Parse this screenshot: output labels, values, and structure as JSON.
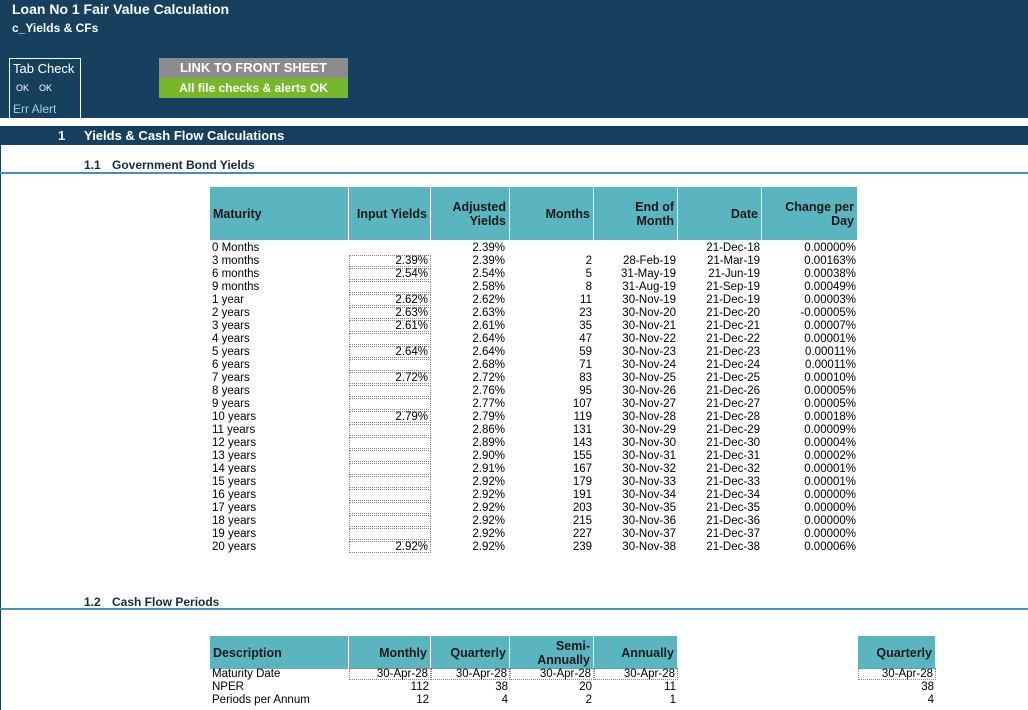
{
  "header": {
    "title": "Loan No 1 Fair Value Calculation",
    "subtitle": "c_Yields & CFs",
    "tab_check": {
      "title": "Tab Check",
      "ok1": "OK",
      "ok2": "OK",
      "err": "Err Alert"
    },
    "link_button": "LINK TO FRONT SHEET",
    "status_button": "All file checks & alerts OK"
  },
  "colors": {
    "header_bg": "#17405f",
    "table_header": "#5bb5c0",
    "link_btn": "#8c8c8c",
    "ok_btn": "#76b82a"
  },
  "section": {
    "number": "1",
    "label": "Yields & Cash Flow Calculations"
  },
  "yields": {
    "number": "1.1",
    "heading": "Government Bond Yields",
    "columns": [
      "Maturity",
      "Input Yields",
      "Adjusted Yields",
      "Months",
      "End of Month",
      "Date",
      "Change per Day"
    ],
    "rows": [
      [
        "0 Months",
        "",
        "2.39%",
        "",
        "",
        "21-Dec-18",
        "0.00000%"
      ],
      [
        "3 months",
        "2.39%",
        "2.39%",
        "2",
        "28-Feb-19",
        "21-Mar-19",
        "0.00163%"
      ],
      [
        "6 months",
        "2.54%",
        "2.54%",
        "5",
        "31-May-19",
        "21-Jun-19",
        "0.00038%"
      ],
      [
        "9 months",
        "",
        "2.58%",
        "8",
        "31-Aug-19",
        "21-Sep-19",
        "0.00049%"
      ],
      [
        "1 year",
        "2.62%",
        "2.62%",
        "11",
        "30-Nov-19",
        "21-Dec-19",
        "0.00003%"
      ],
      [
        "2 years",
        "2.63%",
        "2.63%",
        "23",
        "30-Nov-20",
        "21-Dec-20",
        "-0.00005%"
      ],
      [
        "3 years",
        "2.61%",
        "2.61%",
        "35",
        "30-Nov-21",
        "21-Dec-21",
        "0.00007%"
      ],
      [
        "4 years",
        "",
        "2.64%",
        "47",
        "30-Nov-22",
        "21-Dec-22",
        "0.00001%"
      ],
      [
        "5 years",
        "2.64%",
        "2.64%",
        "59",
        "30-Nov-23",
        "21-Dec-23",
        "0.00011%"
      ],
      [
        "6 years",
        "",
        "2.68%",
        "71",
        "30-Nov-24",
        "21-Dec-24",
        "0.00011%"
      ],
      [
        "7 years",
        "2.72%",
        "2.72%",
        "83",
        "30-Nov-25",
        "21-Dec-25",
        "0.00010%"
      ],
      [
        "8 years",
        "",
        "2.76%",
        "95",
        "30-Nov-26",
        "21-Dec-26",
        "0.00005%"
      ],
      [
        "9 years",
        "",
        "2.77%",
        "107",
        "30-Nov-27",
        "21-Dec-27",
        "0.00005%"
      ],
      [
        "10 years",
        "2.79%",
        "2.79%",
        "119",
        "30-Nov-28",
        "21-Dec-28",
        "0.00018%"
      ],
      [
        "11 years",
        "",
        "2.86%",
        "131",
        "30-Nov-29",
        "21-Dec-29",
        "0.00009%"
      ],
      [
        "12 years",
        "",
        "2.89%",
        "143",
        "30-Nov-30",
        "21-Dec-30",
        "0.00004%"
      ],
      [
        "13 years",
        "",
        "2.90%",
        "155",
        "30-Nov-31",
        "21-Dec-31",
        "0.00002%"
      ],
      [
        "14 years",
        "",
        "2.91%",
        "167",
        "30-Nov-32",
        "21-Dec-32",
        "0.00001%"
      ],
      [
        "15 years",
        "",
        "2.92%",
        "179",
        "30-Nov-33",
        "21-Dec-33",
        "0.00001%"
      ],
      [
        "16 years",
        "",
        "2.92%",
        "191",
        "30-Nov-34",
        "21-Dec-34",
        "0.00000%"
      ],
      [
        "17 years",
        "",
        "2.92%",
        "203",
        "30-Nov-35",
        "21-Dec-35",
        "0.00000%"
      ],
      [
        "18 years",
        "",
        "2.92%",
        "215",
        "30-Nov-36",
        "21-Dec-36",
        "0.00000%"
      ],
      [
        "19 years",
        "",
        "2.92%",
        "227",
        "30-Nov-37",
        "21-Dec-37",
        "0.00000%"
      ],
      [
        "20 years",
        "2.92%",
        "2.92%",
        "239",
        "30-Nov-38",
        "21-Dec-38",
        "0.00006%"
      ]
    ]
  },
  "cashflow": {
    "number": "1.2",
    "heading": "Cash Flow Periods",
    "columns": [
      "Description",
      "Monthly",
      "Quarterly",
      "Semi-Annually",
      "Annually"
    ],
    "side_column": "Quarterly",
    "rows": [
      [
        "Maturity Date",
        "30-Apr-28",
        "30-Apr-28",
        "30-Apr-28",
        "30-Apr-28",
        "30-Apr-28"
      ],
      [
        "NPER",
        "112",
        "38",
        "20",
        "11",
        "38"
      ],
      [
        "Periods per Annum",
        "12",
        "4",
        "2",
        "1",
        "4"
      ]
    ]
  }
}
